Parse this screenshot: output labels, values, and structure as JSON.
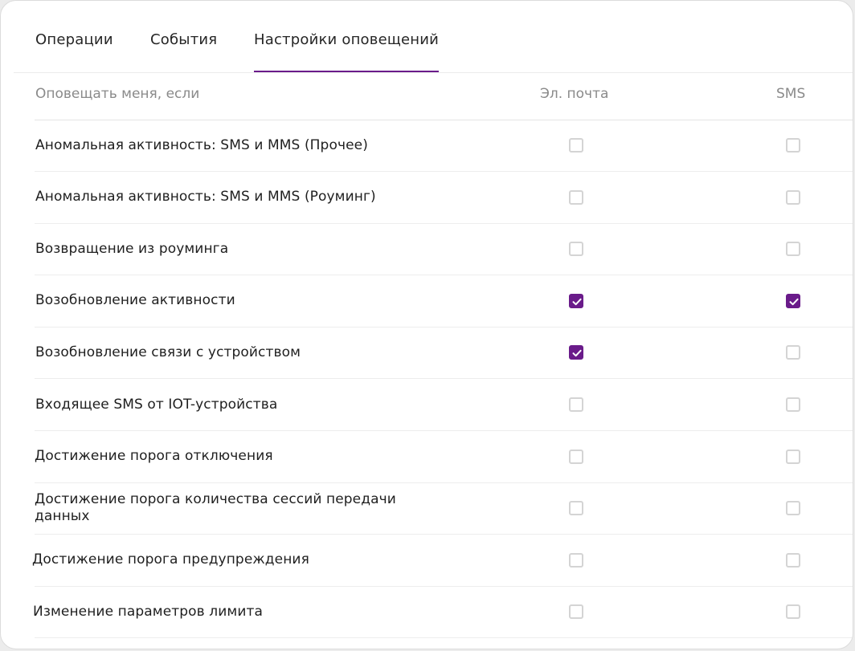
{
  "tabs": [
    {
      "label": "Операции",
      "active": false
    },
    {
      "label": "События",
      "active": false
    },
    {
      "label": "Настройки оповещений",
      "active": true
    }
  ],
  "table": {
    "headers": {
      "condition": "Оповещать меня, если",
      "email": "Эл. почта",
      "sms": "SMS"
    },
    "rows": [
      {
        "label": "Аномальная активность: SMS и MMS (Прочее)",
        "email": false,
        "sms": false
      },
      {
        "label": "Аномальная активность: SMS и MMS (Роуминг)",
        "email": false,
        "sms": false
      },
      {
        "label": "Возвращение из роуминга",
        "email": false,
        "sms": false
      },
      {
        "label": "Возобновление активности",
        "email": true,
        "sms": true
      },
      {
        "label": "Возобновление связи с устройством",
        "email": true,
        "sms": false
      },
      {
        "label": "Входящее SMS от IOT-устройства",
        "email": false,
        "sms": false
      },
      {
        "label": "Достижение порога отключения",
        "email": false,
        "sms": false
      },
      {
        "label": "Достижение порога количества сессий передачи данных",
        "email": false,
        "sms": false
      },
      {
        "label": "Достижение порога предупреждения",
        "email": false,
        "sms": false
      },
      {
        "label": "Изменение параметров лимита",
        "email": false,
        "sms": false
      }
    ]
  },
  "colors": {
    "accent": "#6a1b8a",
    "checkbox_border": "#d4d4d4",
    "header_text": "#8a8a8a"
  }
}
